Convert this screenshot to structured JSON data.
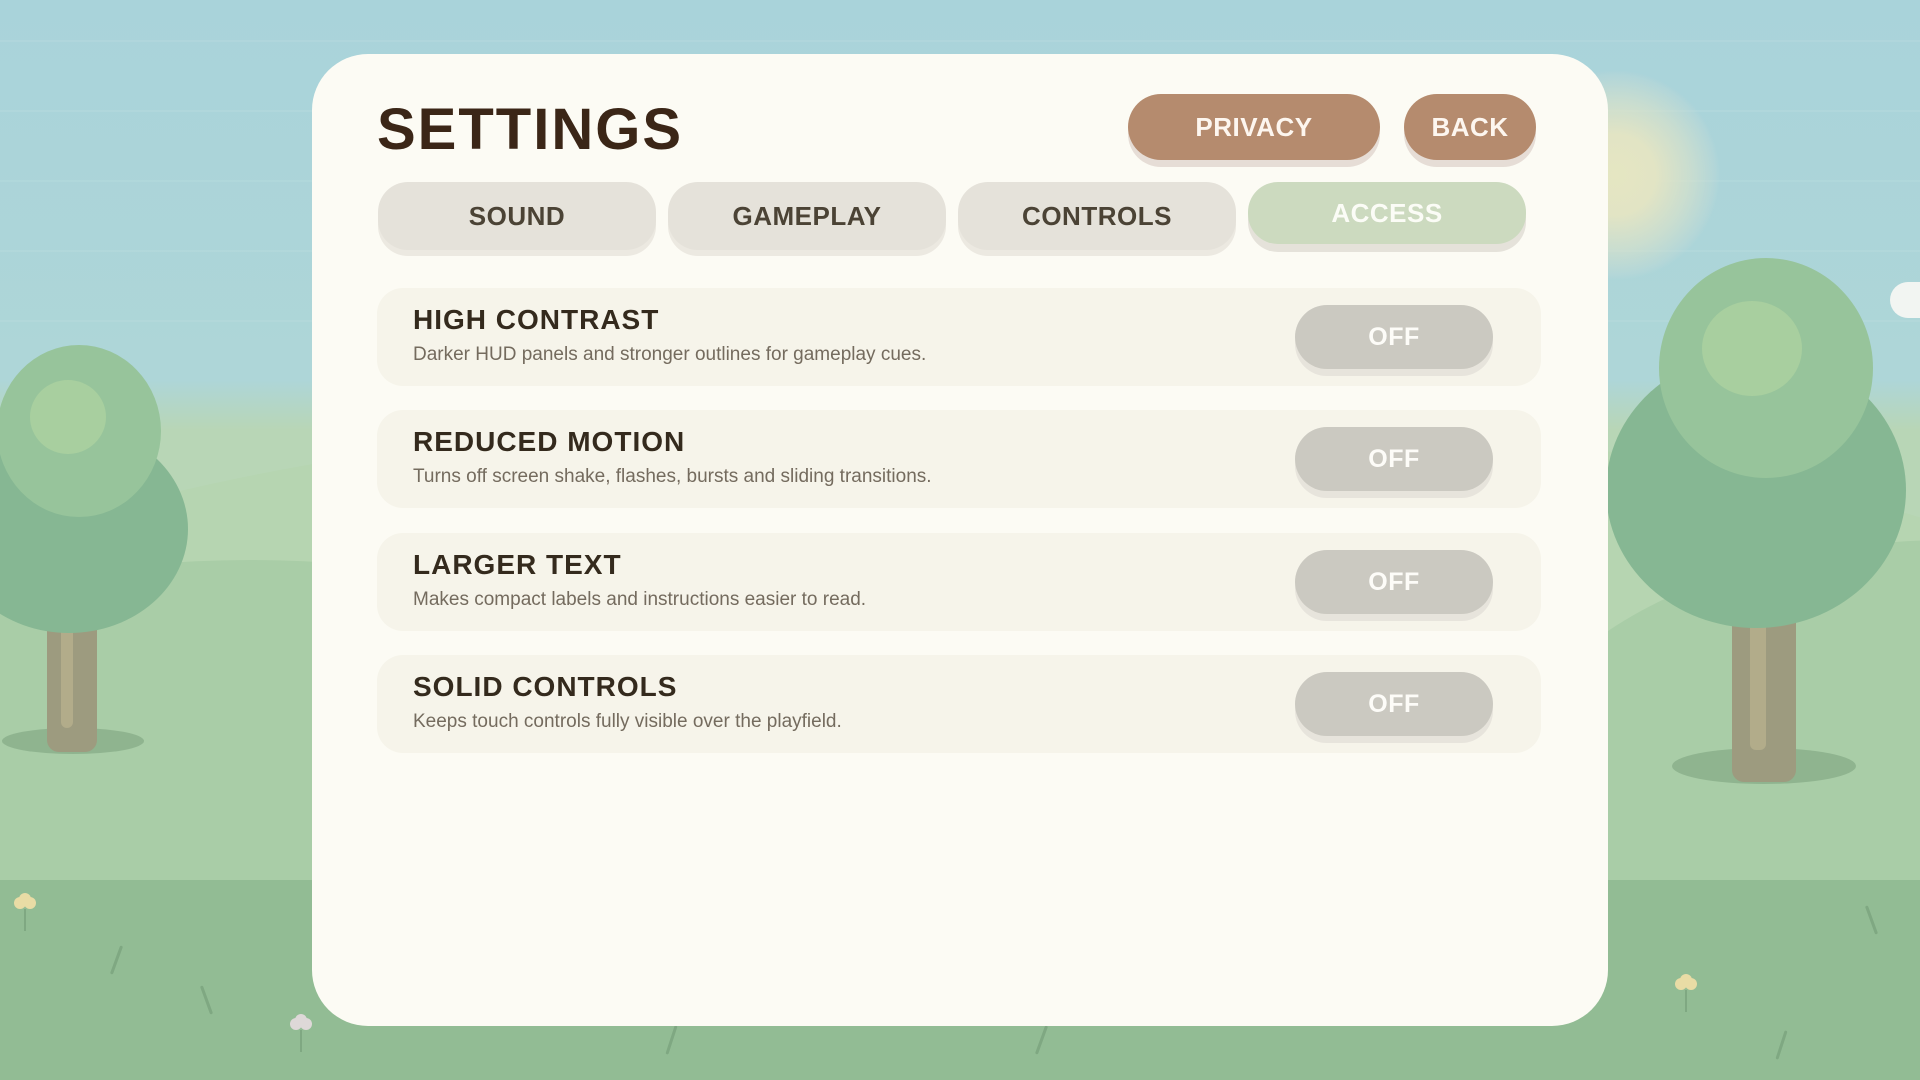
{
  "header": {
    "title": "SETTINGS",
    "privacy_label": "PRIVACY",
    "back_label": "BACK"
  },
  "tabs": [
    {
      "label": "SOUND",
      "active": false
    },
    {
      "label": "GAMEPLAY",
      "active": false
    },
    {
      "label": "CONTROLS",
      "active": false
    },
    {
      "label": "ACCESS",
      "active": true
    }
  ],
  "settings": [
    {
      "title": "HIGH CONTRAST",
      "description": "Darker HUD panels and stronger outlines for gameplay cues.",
      "value": "OFF"
    },
    {
      "title": "REDUCED MOTION",
      "description": "Turns off screen shake, flashes, bursts and sliding transitions.",
      "value": "OFF"
    },
    {
      "title": "LARGER TEXT",
      "description": "Makes compact labels and instructions easier to read.",
      "value": "OFF"
    },
    {
      "title": "SOLID CONTROLS",
      "description": "Keeps touch controls fully visible over the playfield.",
      "value": "OFF"
    }
  ],
  "colors": {
    "panel": "#fcfbf4",
    "accent_brown": "#b58b6e",
    "active_tab": "#ccdabf",
    "toggle_off": "#cbc9c1",
    "sky": "#a9d3da",
    "ground": "#92bc94"
  }
}
